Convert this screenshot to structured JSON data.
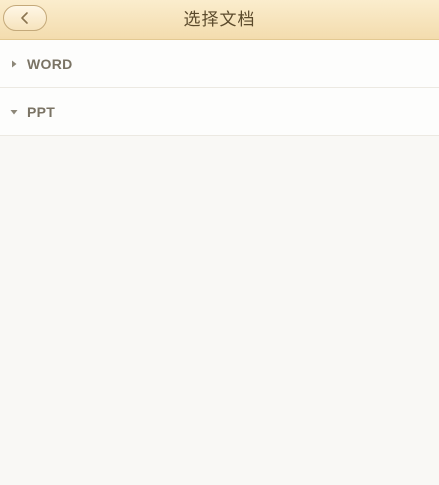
{
  "header": {
    "title": "选择文档",
    "back_icon": "chevron-left-icon"
  },
  "groups": [
    {
      "label": "WORD",
      "expanded": false,
      "icon": "caret-right-icon"
    },
    {
      "label": "PPT",
      "expanded": true,
      "icon": "caret-down-icon"
    }
  ],
  "colors": {
    "header_bg": "#f6e3bc",
    "title_text": "#5b4a2c",
    "label_text": "#7a7364",
    "page_bg": "#f9f8f5"
  }
}
